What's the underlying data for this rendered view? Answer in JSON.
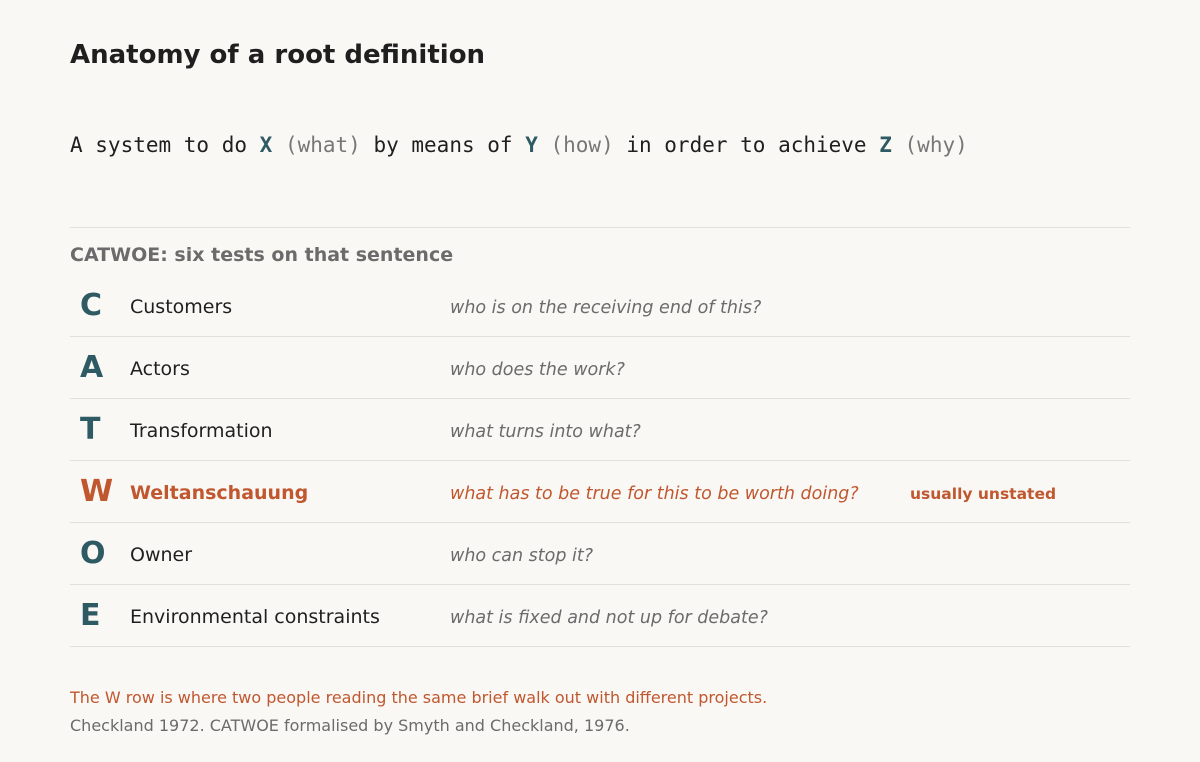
{
  "title": "Anatomy of a root definition",
  "formula": {
    "p1": "A system to do ",
    "x": "X",
    "x_hint": " (what)",
    "p2": " by means of ",
    "y": "Y",
    "y_hint": " (how)",
    "p3": " in order to achieve ",
    "z": "Z",
    "z_hint": " (why)"
  },
  "catwoe": {
    "heading": "CATWOE: six tests on that sentence",
    "rows": [
      {
        "letter": "C",
        "term": "Customers",
        "question": "who is on the receiving end of this?"
      },
      {
        "letter": "A",
        "term": "Actors",
        "question": "who does the work?"
      },
      {
        "letter": "T",
        "term": "Transformation",
        "question": "what turns into what?"
      },
      {
        "letter": "W",
        "term": "Weltanschauung",
        "question": "what has to be true for this to be worth doing?",
        "badge": "usually unstated"
      },
      {
        "letter": "O",
        "term": "Owner",
        "question": "who can stop it?"
      },
      {
        "letter": "E",
        "term": "Environmental constraints",
        "question": "what is fixed and not up for debate?"
      }
    ]
  },
  "note": "The W row is where two people reading the same brief walk out with different projects.",
  "citation": "Checkland 1972. CATWOE formalised by Smyth and Checkland, 1976.",
  "colors": {
    "accent": "#2e5a63",
    "highlight": "#c0572f",
    "muted": "#6b6b6b",
    "background": "#faf8f5"
  }
}
